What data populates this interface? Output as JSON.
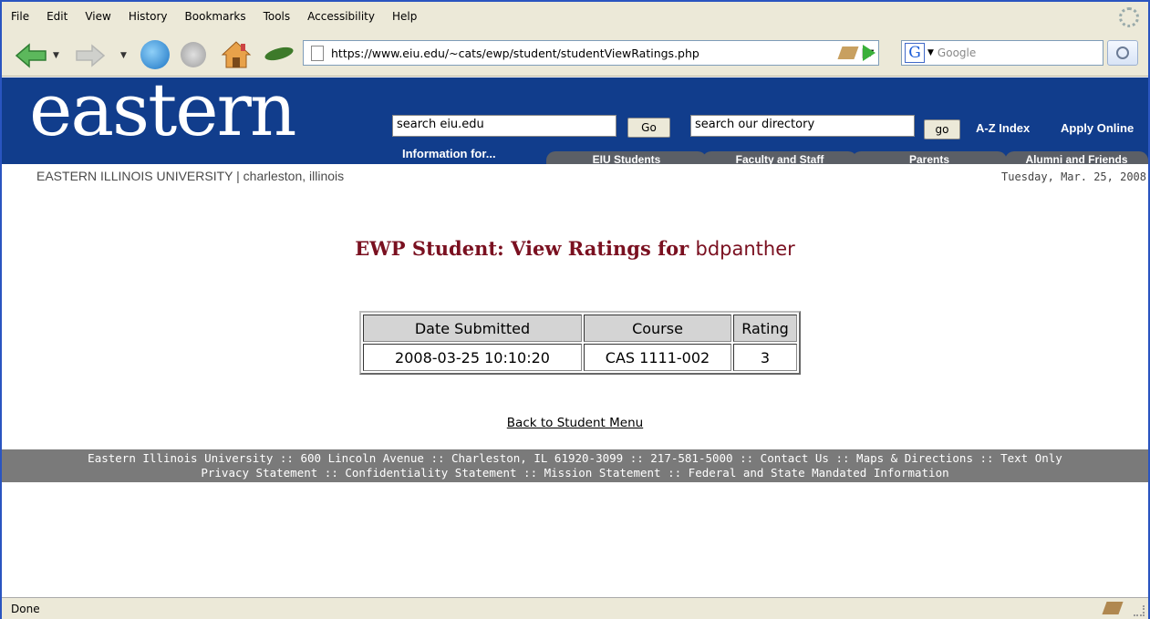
{
  "menu": [
    "File",
    "Edit",
    "View",
    "History",
    "Bookmarks",
    "Tools",
    "Accessibility",
    "Help"
  ],
  "browser": {
    "url": "https://www.eiu.edu/~cats/ewp/student/studentViewRatings.php",
    "search_engine_placeholder": "Google",
    "status": "Done"
  },
  "site": {
    "logo": "eastern",
    "university_line": "EASTERN ILLINOIS UNIVERSITY | charleston, illinois",
    "date": "Tuesday, Mar. 25, 2008",
    "search_site_value": "search eiu.edu",
    "search_site_button": "Go",
    "search_directory_value": "search our directory",
    "search_directory_button": "go",
    "links": [
      "A-Z Index",
      "Apply Online"
    ],
    "info_for": "Information for...",
    "tabs": [
      "EIU Students",
      "Faculty and Staff",
      "Parents",
      "Alumni and Friends"
    ]
  },
  "page": {
    "heading_prefix": "EWP Student: View Ratings for",
    "username": "bdpanther",
    "table": {
      "headers": [
        "Date Submitted",
        "Course",
        "Rating"
      ],
      "rows": [
        [
          "2008-03-25 10:10:20",
          "CAS 1111-002",
          "3"
        ]
      ]
    },
    "back_link": "Back to Student Menu"
  },
  "footer": {
    "line1": "Eastern Illinois University :: 600 Lincoln Avenue :: Charleston, IL 61920-3099 :: 217-581-5000 :: Contact Us :: Maps & Directions :: Text Only",
    "line2": "Privacy Statement :: Confidentiality Statement :: Mission Statement :: Federal and State Mandated Information"
  }
}
